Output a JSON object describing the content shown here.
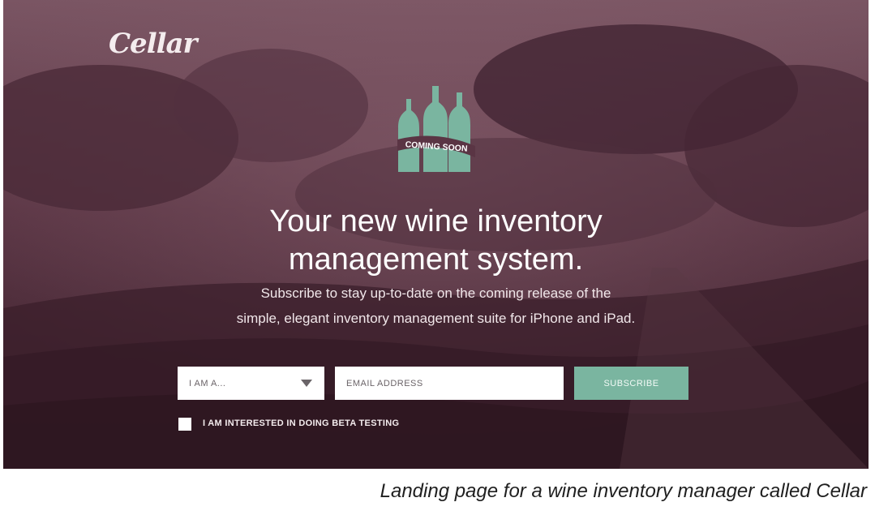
{
  "brand": {
    "logo_text": "Cellar"
  },
  "badge": {
    "text": "COMING SOON",
    "icon": "wine-bottles-icon",
    "color": "#7ab5a0"
  },
  "hero": {
    "headline_line1": "Your new wine inventory",
    "headline_line2": "management system.",
    "sub_line1": "Subscribe to stay up-to-date on the coming release of the",
    "sub_line2": "simple, elegant inventory management suite for iPhone and iPad."
  },
  "form": {
    "role_select": {
      "label": "I AM A...",
      "icon": "chevron-down-icon"
    },
    "email_input": {
      "placeholder": "EMAIL ADDRESS",
      "value": ""
    },
    "subscribe_label": "SUBSCRIBE",
    "beta_checkbox_label": "I AM INTERESTED IN DOING BETA TESTING"
  },
  "caption": "Landing page for a wine inventory manager called Cellar",
  "colors": {
    "overlay": "#4a2a36",
    "accent": "#7ab5a0"
  }
}
